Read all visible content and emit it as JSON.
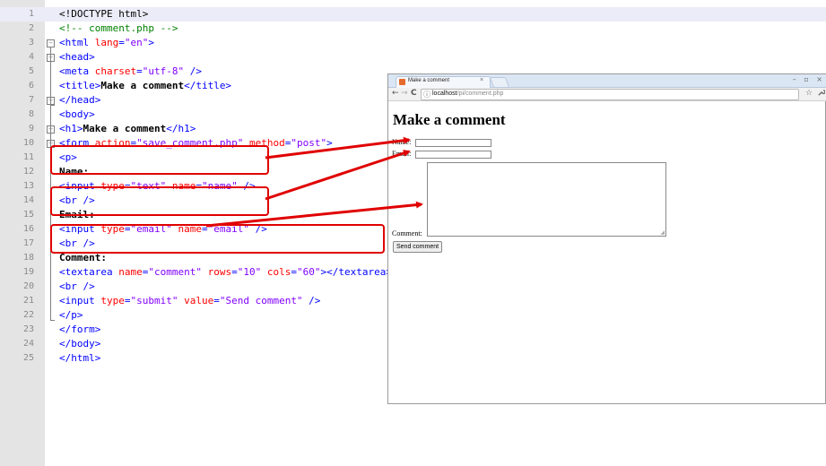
{
  "editor": {
    "line_numbers": [
      "1",
      "2",
      "3",
      "4",
      "5",
      "6",
      "7",
      "8",
      "9",
      "10",
      "11",
      "12",
      "13",
      "14",
      "15",
      "16",
      "17",
      "18",
      "19",
      "20",
      "21",
      "22",
      "23",
      "24",
      "25"
    ],
    "lines": [
      [
        {
          "c": "doc",
          "t": "<!DOCTYPE html>"
        }
      ],
      [
        {
          "c": "comment",
          "t": "<!-- comment.php -->"
        }
      ],
      [
        {
          "c": "tag",
          "t": "<html "
        },
        {
          "c": "attr",
          "t": "lang"
        },
        {
          "c": "tag",
          "t": "="
        },
        {
          "c": "val",
          "t": "\"en\""
        },
        {
          "c": "tag",
          "t": ">"
        }
      ],
      [
        {
          "c": "tag",
          "t": "<head>"
        }
      ],
      [
        {
          "c": "tag",
          "t": "<meta "
        },
        {
          "c": "attr",
          "t": "charset"
        },
        {
          "c": "tag",
          "t": "="
        },
        {
          "c": "val",
          "t": "\"utf-8\""
        },
        {
          "c": "tag",
          "t": " />"
        }
      ],
      [
        {
          "c": "tag",
          "t": "<title>"
        },
        {
          "c": "text",
          "t": "Make a comment"
        },
        {
          "c": "tag",
          "t": "</title>"
        }
      ],
      [
        {
          "c": "tag",
          "t": "</head>"
        }
      ],
      [
        {
          "c": "tag",
          "t": "<body>"
        }
      ],
      [
        {
          "c": "tag",
          "t": "<h1>"
        },
        {
          "c": "text",
          "t": "Make a comment"
        },
        {
          "c": "tag",
          "t": "</h1>"
        }
      ],
      [
        {
          "c": "tag",
          "t": "<form "
        },
        {
          "c": "attr",
          "t": "action"
        },
        {
          "c": "tag",
          "t": "="
        },
        {
          "c": "val",
          "t": "\"save_comment.php\""
        },
        {
          "c": "tag",
          "t": " "
        },
        {
          "c": "attr",
          "t": "method"
        },
        {
          "c": "tag",
          "t": "="
        },
        {
          "c": "val",
          "t": "\"post\""
        },
        {
          "c": "tag",
          "t": ">"
        }
      ],
      [
        {
          "c": "tag",
          "t": "<p>"
        }
      ],
      [
        {
          "c": "text",
          "t": "Name:"
        }
      ],
      [
        {
          "c": "tag",
          "t": "<input "
        },
        {
          "c": "attr",
          "t": "type"
        },
        {
          "c": "tag",
          "t": "="
        },
        {
          "c": "val",
          "t": "\"text\""
        },
        {
          "c": "tag",
          "t": " "
        },
        {
          "c": "attr",
          "t": "name"
        },
        {
          "c": "tag",
          "t": "="
        },
        {
          "c": "val",
          "t": "\"name\""
        },
        {
          "c": "tag",
          "t": " />"
        }
      ],
      [
        {
          "c": "tag",
          "t": "<br />"
        }
      ],
      [
        {
          "c": "text",
          "t": "Email:"
        }
      ],
      [
        {
          "c": "tag",
          "t": "<input "
        },
        {
          "c": "attr",
          "t": "type"
        },
        {
          "c": "tag",
          "t": "="
        },
        {
          "c": "val",
          "t": "\"email\""
        },
        {
          "c": "tag",
          "t": " "
        },
        {
          "c": "attr",
          "t": "name"
        },
        {
          "c": "tag",
          "t": "="
        },
        {
          "c": "val",
          "t": "\"email\""
        },
        {
          "c": "tag",
          "t": " />"
        }
      ],
      [
        {
          "c": "tag",
          "t": "<br />"
        }
      ],
      [
        {
          "c": "text",
          "t": "Comment:"
        }
      ],
      [
        {
          "c": "tag",
          "t": "<textarea "
        },
        {
          "c": "attr",
          "t": "name"
        },
        {
          "c": "tag",
          "t": "="
        },
        {
          "c": "val",
          "t": "\"comment\""
        },
        {
          "c": "tag",
          "t": " "
        },
        {
          "c": "attr",
          "t": "rows"
        },
        {
          "c": "tag",
          "t": "="
        },
        {
          "c": "val",
          "t": "\"10\""
        },
        {
          "c": "tag",
          "t": " "
        },
        {
          "c": "attr",
          "t": "cols"
        },
        {
          "c": "tag",
          "t": "="
        },
        {
          "c": "val",
          "t": "\"60\""
        },
        {
          "c": "tag",
          "t": "></textarea>"
        }
      ],
      [
        {
          "c": "tag",
          "t": "<br />"
        }
      ],
      [
        {
          "c": "tag",
          "t": "<input "
        },
        {
          "c": "attr",
          "t": "type"
        },
        {
          "c": "tag",
          "t": "="
        },
        {
          "c": "val",
          "t": "\"submit\""
        },
        {
          "c": "tag",
          "t": " "
        },
        {
          "c": "attr",
          "t": "value"
        },
        {
          "c": "tag",
          "t": "="
        },
        {
          "c": "val",
          "t": "\"Send comment\""
        },
        {
          "c": "tag",
          "t": " />"
        }
      ],
      [
        {
          "c": "tag",
          "t": "</p>"
        }
      ],
      [
        {
          "c": "tag",
          "t": "</form>"
        }
      ],
      [
        {
          "c": "tag",
          "t": "</body>"
        }
      ],
      [
        {
          "c": "tag",
          "t": "</html>"
        }
      ]
    ],
    "syntax_colors": {
      "tag": "#0000ff",
      "attr": "#ff0000",
      "val": "#8000ff",
      "comment": "#008000",
      "text": "#000000"
    },
    "highlight_color": "#e00000"
  },
  "browser": {
    "tab_title": "Make a comment",
    "tab_close": "×",
    "window_buttons": "– ▫ ×",
    "nav": {
      "back": "←",
      "forward": "→",
      "reload": "C"
    },
    "url_icon": "ⓘ",
    "url_host": "localhost",
    "url_path": "/pi/comment.php",
    "star_icon": "☆",
    "wrench_icon": "🔧",
    "page": {
      "heading": "Make a comment",
      "name_label": "Name:",
      "email_label": "Email:",
      "comment_label": "Comment:",
      "submit_label": "Send comment"
    }
  }
}
